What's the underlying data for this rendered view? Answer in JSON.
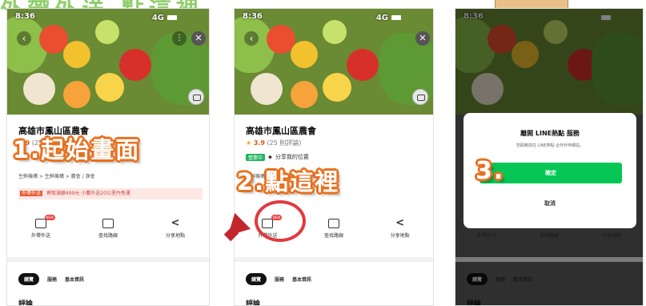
{
  "top_title": "外帶外送 點這裡",
  "time": "8:36",
  "network": "4G",
  "store_name": "高雄市鳳山區農會",
  "rating": {
    "score": "3.9",
    "count": "(25 則評論)"
  },
  "tag_open": "營業中",
  "share_location": "分享我的位置",
  "categories": "生鮮機構 > 生鮮機構 > 農會 / 漁會",
  "promo": {
    "tag": "外帶外送",
    "text": "寄取滿額499元 小農外送20公里內免運"
  },
  "actions": [
    {
      "label": "外帶外送",
      "badge": "NEW",
      "icon": "delivery-icon"
    },
    {
      "label": "查找路線",
      "icon": "map-icon"
    },
    {
      "label": "分享地點",
      "icon": "share-icon"
    }
  ],
  "tabs": [
    "總覽",
    "服務",
    "基本資訊"
  ],
  "review_heading": "評論",
  "step_labels": [
    "1.起始畫面",
    "2.點這裡",
    "3."
  ],
  "dialog": {
    "title": "離開 LINE熱點 服務",
    "subtitle": "您即將前往 LINE熱點 合作伙伴網站。",
    "confirm": "確定",
    "cancel": "取消"
  },
  "colors": {
    "accent_orange": "#e8701e",
    "line_green": "#06c755",
    "highlight_red": "#e03a3e"
  }
}
